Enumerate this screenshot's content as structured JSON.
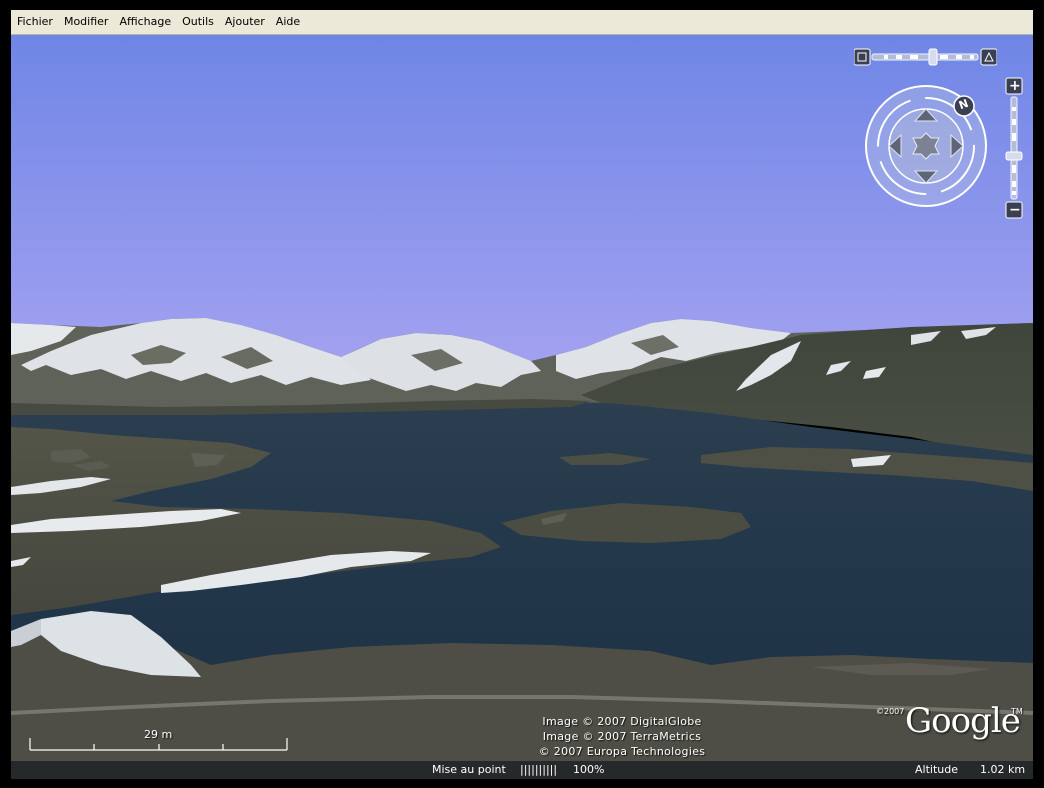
{
  "menu": {
    "items": [
      {
        "label": "Fichier"
      },
      {
        "label": "Modifier"
      },
      {
        "label": "Affichage"
      },
      {
        "label": "Outils"
      },
      {
        "label": "Ajouter"
      },
      {
        "label": "Aide"
      }
    ]
  },
  "navigation": {
    "compass_letter": "N",
    "zoom_in_symbol": "+",
    "zoom_out_symbol": "−"
  },
  "credits": {
    "line1": "Image © 2007 DigitalGlobe",
    "line2": "Image © 2007 TerraMetrics",
    "line3": "© 2007 Europa Technologies"
  },
  "scale": {
    "label": "29 m"
  },
  "logo": {
    "year": "©2007",
    "word": "Google",
    "tm": "TM"
  },
  "status": {
    "streaming_label": "Mise au point",
    "streaming_bars": "||||||||||",
    "streaming_percent": "100%",
    "altitude_label": "Altitude",
    "altitude_value": "1.02 km"
  },
  "colors": {
    "sky_top": "#6f86e6",
    "sky_bottom": "#9e9ef0",
    "water": "#25394b",
    "snow": "#e8ecef",
    "rock": "#4f5248",
    "menubar": "#ece9d8"
  }
}
